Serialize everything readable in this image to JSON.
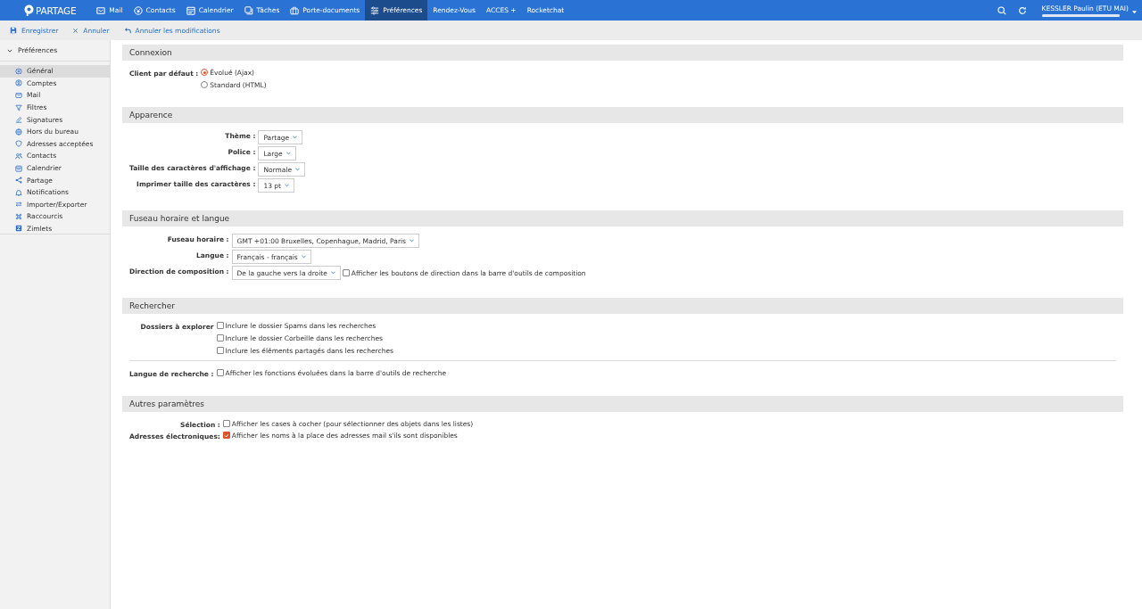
{
  "top_bar": {
    "logo": "PARTAGE",
    "nav": [
      {
        "label": "Mail",
        "selected": false
      },
      {
        "label": "Contacts",
        "selected": false
      },
      {
        "label": "Calendrier",
        "selected": false
      },
      {
        "label": "Tâches",
        "selected": false
      },
      {
        "label": "Porte-documents",
        "selected": false
      },
      {
        "label": "Préférences",
        "selected": true
      },
      {
        "label": "Rendez-Vous",
        "selected": false
      },
      {
        "label": "ACCES +",
        "selected": false
      },
      {
        "label": "Rocketchat",
        "selected": false
      }
    ],
    "user": {
      "name": "KESSLER Paulin (ETU MAI)",
      "level": 1
    }
  },
  "toolbar": [
    "Enregistrer",
    "Annuler",
    "Annuler les modifications"
  ],
  "sidebar": {
    "root": {
      "label": "Préférences",
      "expanded": true,
      "children": [
        {
          "label": "Général",
          "selected": true
        },
        {
          "label": "Comptes",
          "selected": false
        },
        {
          "label": "Mail",
          "selected": false
        },
        {
          "label": "Filtres",
          "selected": false
        },
        {
          "label": "Signatures",
          "selected": false
        },
        {
          "label": "Hors du bureau",
          "selected": false
        },
        {
          "label": "Adresses acceptées",
          "selected": false
        },
        {
          "label": "Contacts",
          "selected": false
        },
        {
          "label": "Calendrier",
          "selected": false
        },
        {
          "label": "Partage",
          "selected": false
        },
        {
          "label": "Notifications",
          "selected": false
        },
        {
          "label": "Importer/Exporter",
          "selected": false
        },
        {
          "label": "Raccourcis",
          "selected": false
        },
        {
          "label": "Zimlets",
          "selected": false
        }
      ]
    }
  },
  "sections": [
    {
      "title": "Connexion",
      "rows": [
        {
          "label": "Client par défaut :",
          "kind": "radio",
          "options": [
            {
              "label": "Évolué (Ajax)",
              "selected": true
            },
            {
              "label": "Standard (HTML)",
              "selected": false
            }
          ]
        }
      ]
    },
    {
      "title": "Apparence",
      "rows": [
        {
          "label": "Thème :",
          "kind": "select",
          "value": "Partage"
        },
        {
          "label": "Police :",
          "kind": "select",
          "value": "Large"
        },
        {
          "label": "Taille des caractères d'affichage :",
          "kind": "select",
          "value": "Normale"
        },
        {
          "label": "Imprimer taille des caractères :",
          "kind": "select",
          "value": "13 pt"
        }
      ]
    },
    {
      "title": "Fuseau horaire et langue",
      "rows": [
        {
          "label": "Fuseau horaire :",
          "kind": "select",
          "value": "GMT +01:00 Bruxelles, Copenhague, Madrid, Paris"
        },
        {
          "label": "Langue :",
          "kind": "select",
          "value": "Français - français"
        },
        {
          "label": "Direction de composition :",
          "kind": "select",
          "value": "De la gauche vers la droite",
          "checkbox": {
            "label": "Afficher les boutons de direction dans la barre d'outils de composition",
            "checked": false
          }
        }
      ]
    },
    {
      "title": "Rechercher",
      "rows": [
        {
          "label": "Dossiers à explorer",
          "kind": "checks",
          "options": [
            {
              "label": "Inclure le dossier Spams dans les recherches",
              "checked": false
            },
            {
              "label": "Inclure le dossier Corbeille dans les recherches",
              "checked": false
            },
            {
              "label": "Inclure les éléments partagés dans les recherches",
              "checked": false
            }
          ]
        },
        {
          "label": "Langue de recherche :",
          "kind": "checks",
          "separated": true,
          "options": [
            {
              "label": "Afficher les fonctions évoluées dans la barre d'outils de recherche",
              "checked": false
            }
          ]
        }
      ]
    },
    {
      "title": "Autres paramètres",
      "rows": [
        {
          "label": "Sélection :",
          "kind": "checks",
          "options": [
            {
              "label": "Afficher les cases à cocher (pour sélectionner des objets dans les listes)",
              "checked": false
            }
          ]
        },
        {
          "label": "Adresses électroniques:",
          "kind": "checks",
          "options": [
            {
              "label": "Afficher les noms à la place des adresses mail s'ils sont disponibles",
              "checked": true
            }
          ]
        }
      ]
    }
  ]
}
